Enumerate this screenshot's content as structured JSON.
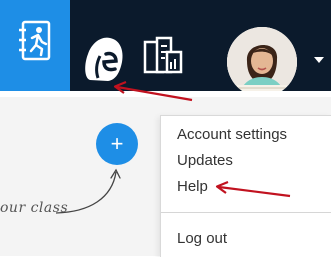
{
  "header": {
    "nav_icons": [
      "class-dashboard-icon",
      "backpack-icon",
      "reports-icon"
    ],
    "active_color": "#1e8ee6",
    "background_color": "#0b1a2c",
    "avatar": "user-avatar",
    "menu_caret": "chevron-down-icon"
  },
  "main": {
    "add_button_label": "+",
    "hint_text": "our class"
  },
  "account_menu": {
    "items": [
      "Account settings",
      "Updates",
      "Help",
      "Log out"
    ]
  },
  "annotations": {
    "arrow_color": "#c1121f"
  }
}
